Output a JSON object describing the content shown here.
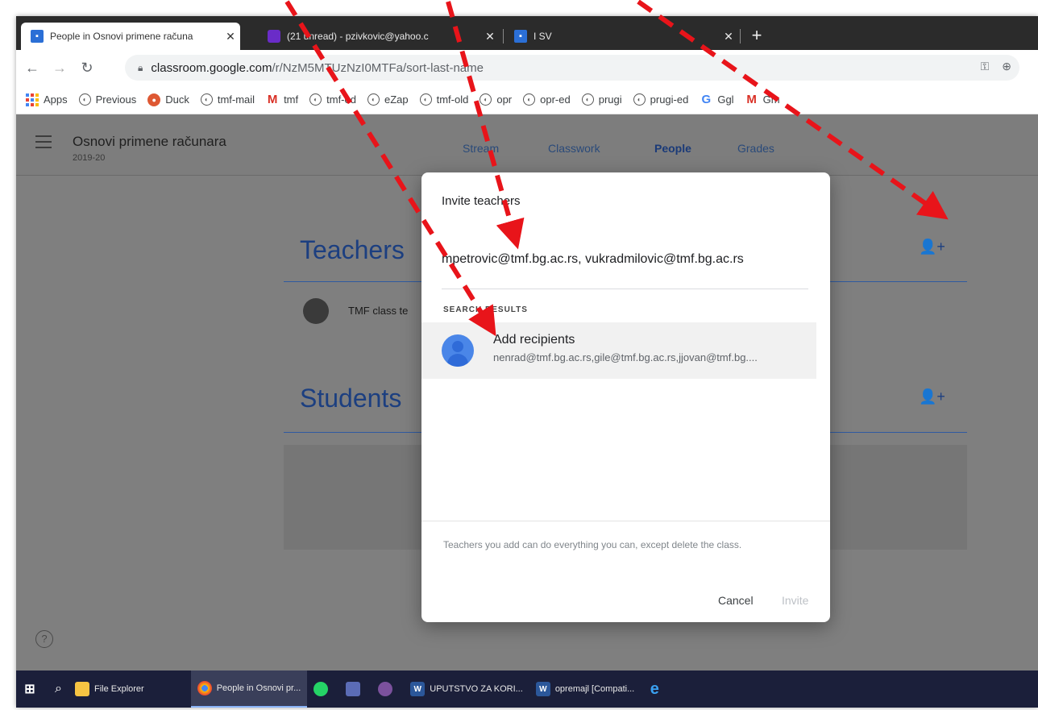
{
  "browser": {
    "tabs": [
      {
        "title": "People in Osnovi primene računa",
        "close": "✕"
      },
      {
        "title": "(21 unread) - pzivkovic@yahoo.c",
        "close": "✕"
      },
      {
        "title": "I SV",
        "close": "✕"
      }
    ],
    "new_tab": "+",
    "url_host": "classroom.google.com",
    "url_path": "/r/NzM5MTUzNzI0MTFa/sort-last-name"
  },
  "bookmarks": [
    "Apps",
    "Previous",
    "Duck",
    "tmf-mail",
    "tmf",
    "tmf-ed",
    "eZap",
    "tmf-old",
    "opr",
    "opr-ed",
    "prugi",
    "prugi-ed",
    "Ggl",
    "Gm"
  ],
  "classroom": {
    "class_name": "Osnovi primene računara",
    "year": "2019-20",
    "nav": [
      "Stream",
      "Classwork",
      "People",
      "Grades"
    ],
    "teachers_title": "Teachers",
    "students_title": "Students",
    "teacher_name": "TMF class te",
    "help": "?"
  },
  "modal": {
    "title": "Invite teachers",
    "input_value": "mpetrovic@tmf.bg.ac.rs, vukradmilovic@tmf.bg.ac.rs",
    "search_label": "SEARCH RESULTS",
    "result_name": "Add recipients",
    "result_emails": "nenrad@tmf.bg.ac.rs,gile@tmf.bg.ac.rs,jjovan@tmf.bg....",
    "note": "Teachers you add can do everything you can, except delete the class.",
    "cancel": "Cancel",
    "invite": "Invite"
  },
  "taskbar": {
    "items": [
      "File Explorer",
      "People in Osnovi pr...",
      "UPUTSTVO ZA KORI...",
      "opremajl [Compati..."
    ]
  },
  "colors": {
    "accent": "#1c3f80",
    "arrow": "#e8141a"
  }
}
